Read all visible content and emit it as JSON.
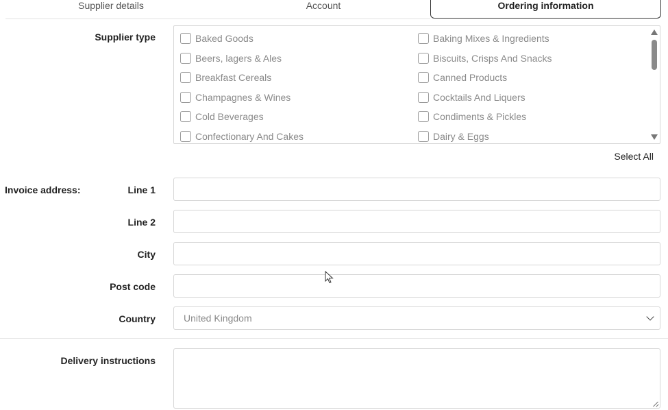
{
  "tabs": [
    {
      "label": "Supplier details"
    },
    {
      "label": "Account"
    },
    {
      "label": "Ordering information"
    }
  ],
  "supplier_type": {
    "label": "Supplier type",
    "options": [
      "Baked Goods",
      "Baking Mixes & Ingredients",
      "Beers, lagers & Ales",
      "Biscuits, Crisps And Snacks",
      "Breakfast Cereals",
      "Canned Products",
      "Champagnes & Wines",
      "Cocktails And Liquers",
      "Cold Beverages",
      "Condiments & Pickles",
      "Confectionary And Cakes",
      "Dairy & Eggs"
    ],
    "select_all": "Select All"
  },
  "invoice_address": {
    "label": "Invoice address:",
    "line1_label": "Line 1",
    "line2_label": "Line 2",
    "city_label": "City",
    "postcode_label": "Post code",
    "country_label": "Country",
    "country_value": "United Kingdom"
  },
  "delivery": {
    "label": "Delivery instructions"
  },
  "colors": {
    "accent": "#333333",
    "border": "#d6d6d6",
    "muted_text": "#8a8a8a"
  }
}
